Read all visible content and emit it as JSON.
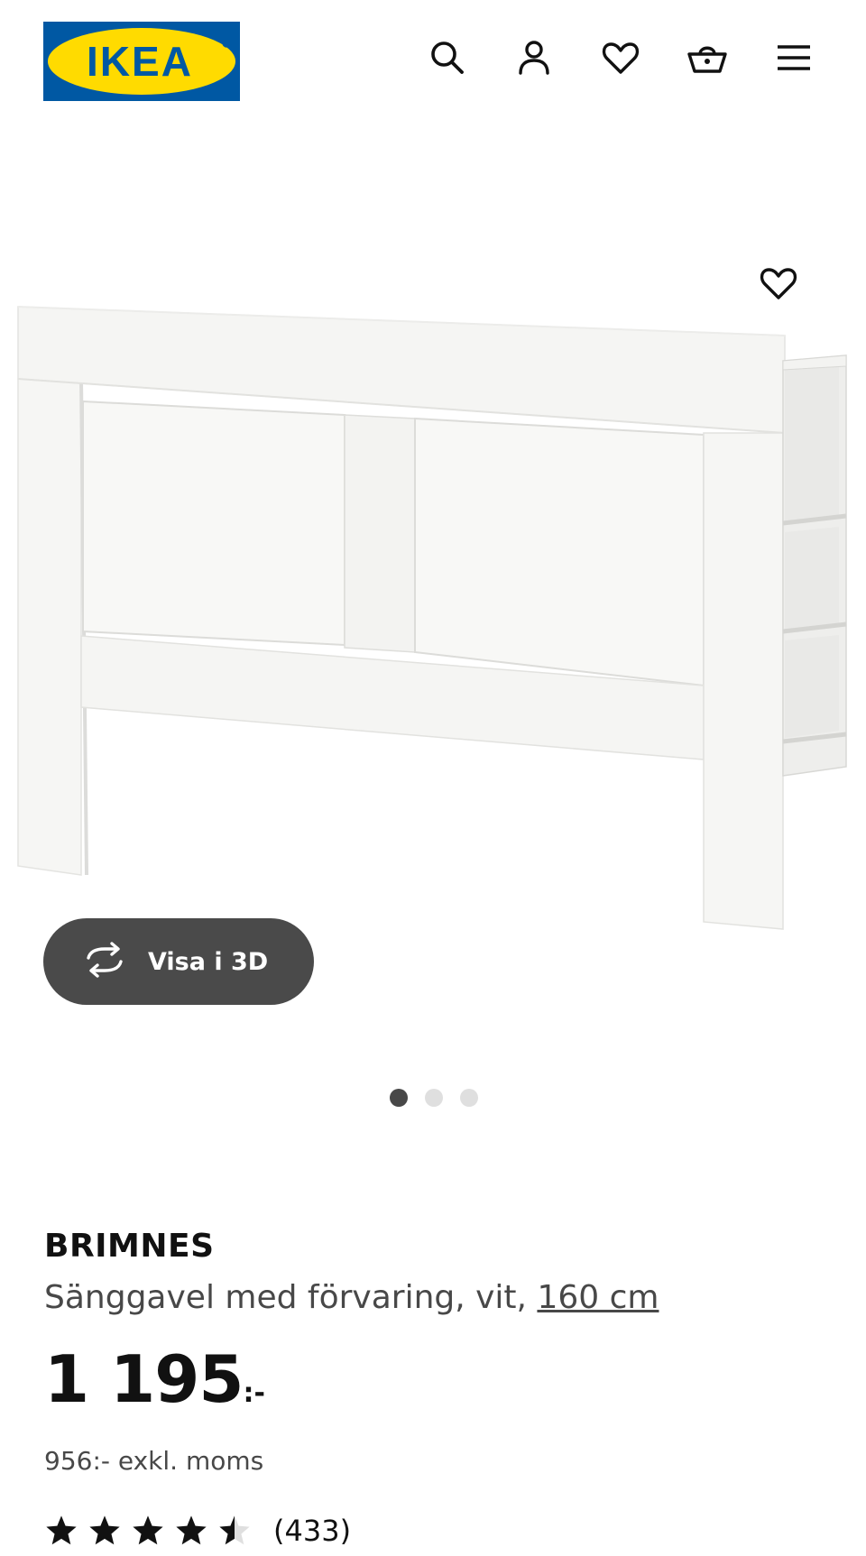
{
  "brand_colors": {
    "logo_blue": "#0058A3",
    "logo_yellow": "#FFDB00",
    "button_dark": "#4A4A4A"
  },
  "header": {
    "logo_text": "IKEA",
    "icons": [
      "search-icon",
      "user-icon",
      "heart-icon",
      "basket-icon",
      "menu-icon"
    ]
  },
  "gallery": {
    "view_3d_label": "Visa i 3D",
    "slides_total": 3,
    "active_slide": 1
  },
  "product": {
    "name": "BRIMNES",
    "description": "Sänggavel med förvaring, vit, ",
    "size_link": "160 cm",
    "price_integer": "1 195",
    "price_suffix": ":-",
    "price_excl_vat": "956:- exkl. moms",
    "rating_value": 4.5,
    "rating_max": 5,
    "review_count": "(433)"
  }
}
